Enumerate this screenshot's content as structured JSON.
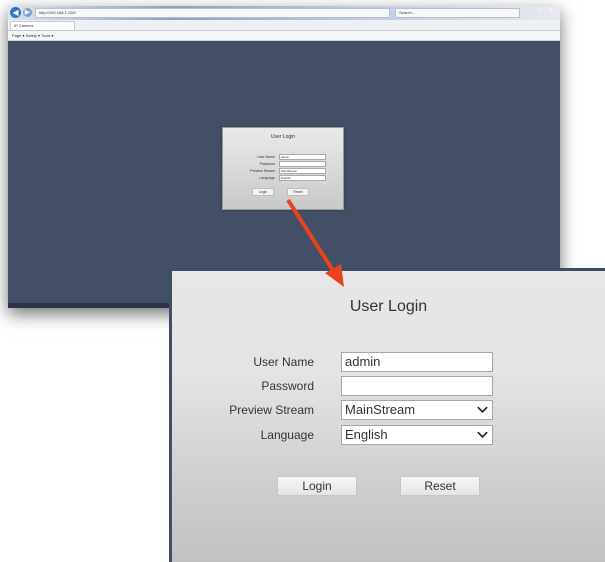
{
  "browser": {
    "address_text": "http://192.168.1.100/",
    "tab_label": "IP Camera",
    "search_placeholder": "Search...",
    "command_bar": "Page ▾  Safety ▾  Tools ▾",
    "window_buttons": "– □ ×"
  },
  "login": {
    "title": "User Login",
    "username_label": "User Name",
    "username_value": "admin",
    "password_label": "Password",
    "password_value": "",
    "preview_label": "Preview Stream",
    "preview_value": "MainStream",
    "language_label": "Language",
    "language_value": "English",
    "login_button": "Login",
    "reset_button": "Reset"
  },
  "icons": {
    "back": "back-arrow-icon",
    "forward": "forward-arrow-icon",
    "dropdown": "chevron-down-icon",
    "callout": "red-arrow-icon"
  },
  "colors": {
    "desktop_bg": "#434f66",
    "accent_arrow": "#e8431a"
  }
}
